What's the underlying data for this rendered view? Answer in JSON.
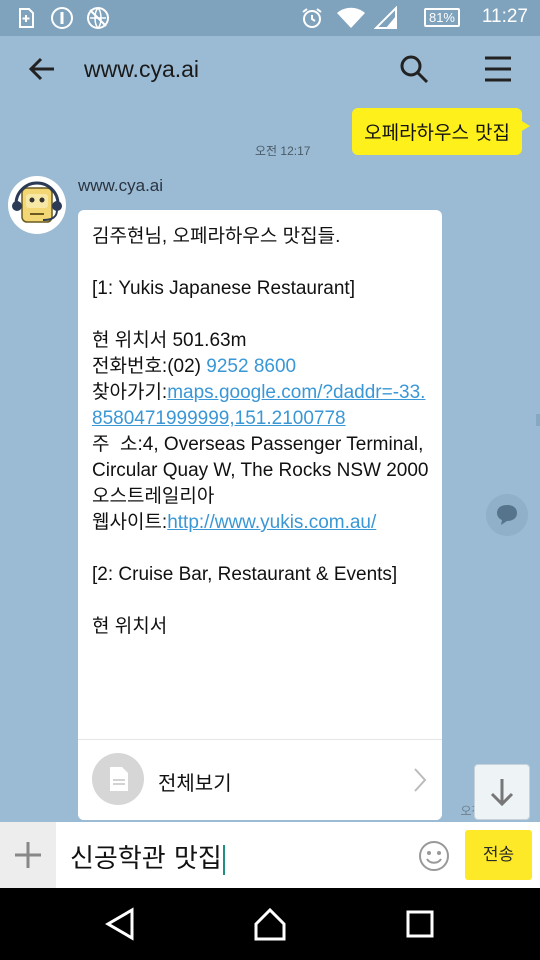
{
  "status_bar": {
    "time": "11:27",
    "battery": "81%"
  },
  "app_bar": {
    "title": "www.cya.ai"
  },
  "chat": {
    "outgoing": {
      "text": "오페라하우스 맛집",
      "time": "오전 12:17"
    },
    "incoming": {
      "sender": "www.cya.ai",
      "greeting": "김주현님, 오페라하우스 맛집들.",
      "item1_title": "[1: Yukis Japanese Restaurant]",
      "item1_distance": "현 위치서 501.63m",
      "item1_phone_label": "전화번호:(02) ",
      "item1_phone": "9252 8600",
      "item1_nav_label": "찾아가기:",
      "item1_nav_link": "maps.google.com/?daddr=-33.8580471999999,151.2100778",
      "item1_address": "주  소:4, Overseas Passenger Terminal, Circular Quay W, The Rocks NSW 2000 오스트레일리아",
      "item1_web_label": "웹사이트:",
      "item1_web_link": "http://www.yukis.com.au/",
      "item2_title": "[2: Cruise Bar, Restaurant & Events]",
      "item2_distance": "현 위치서",
      "view_all": "전체보기",
      "time": "오전 12:1?"
    }
  },
  "input": {
    "text": "신공학관 맛집",
    "send_label": "전송"
  },
  "colors": {
    "background": "#9bbbd4",
    "accent_yellow": "#fef01b",
    "link": "#3a97d6"
  }
}
